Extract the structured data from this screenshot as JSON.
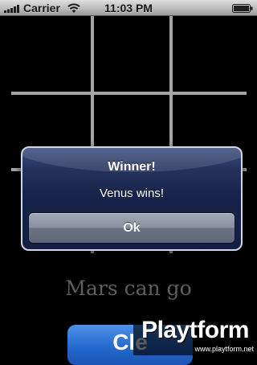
{
  "status_bar": {
    "carrier": "Carrier",
    "time": "11:03 PM",
    "icons": [
      "signal-bars-icon",
      "wifi-icon",
      "battery-icon"
    ]
  },
  "board": {
    "cells": [
      {
        "id": "cell-1",
        "mark": ""
      },
      {
        "id": "cell-2",
        "mark": ""
      },
      {
        "id": "cell-3",
        "mark": ""
      },
      {
        "id": "cell-4",
        "mark": ""
      },
      {
        "id": "cell-5",
        "mark": ""
      },
      {
        "id": "cell-6",
        "mark": ""
      },
      {
        "id": "cell-7",
        "mark": ""
      },
      {
        "id": "cell-8",
        "mark": ""
      },
      {
        "id": "cell-9",
        "mark": ""
      }
    ]
  },
  "alert": {
    "title": "Winner!",
    "message": "Venus wins!",
    "button_label": "Ok"
  },
  "turn_label": "Mars can go",
  "clear_button": {
    "label": "Cle"
  },
  "watermark": {
    "logo": "Playtform",
    "url": "www.playtform.net"
  },
  "colors": {
    "background": "#000000",
    "grid_lines": "#b4b4b4",
    "alert_background": "#1a2750",
    "alert_border": "#cfd6e6",
    "turn_label": "#5e5e5e",
    "clear_button": "#2469cf"
  }
}
